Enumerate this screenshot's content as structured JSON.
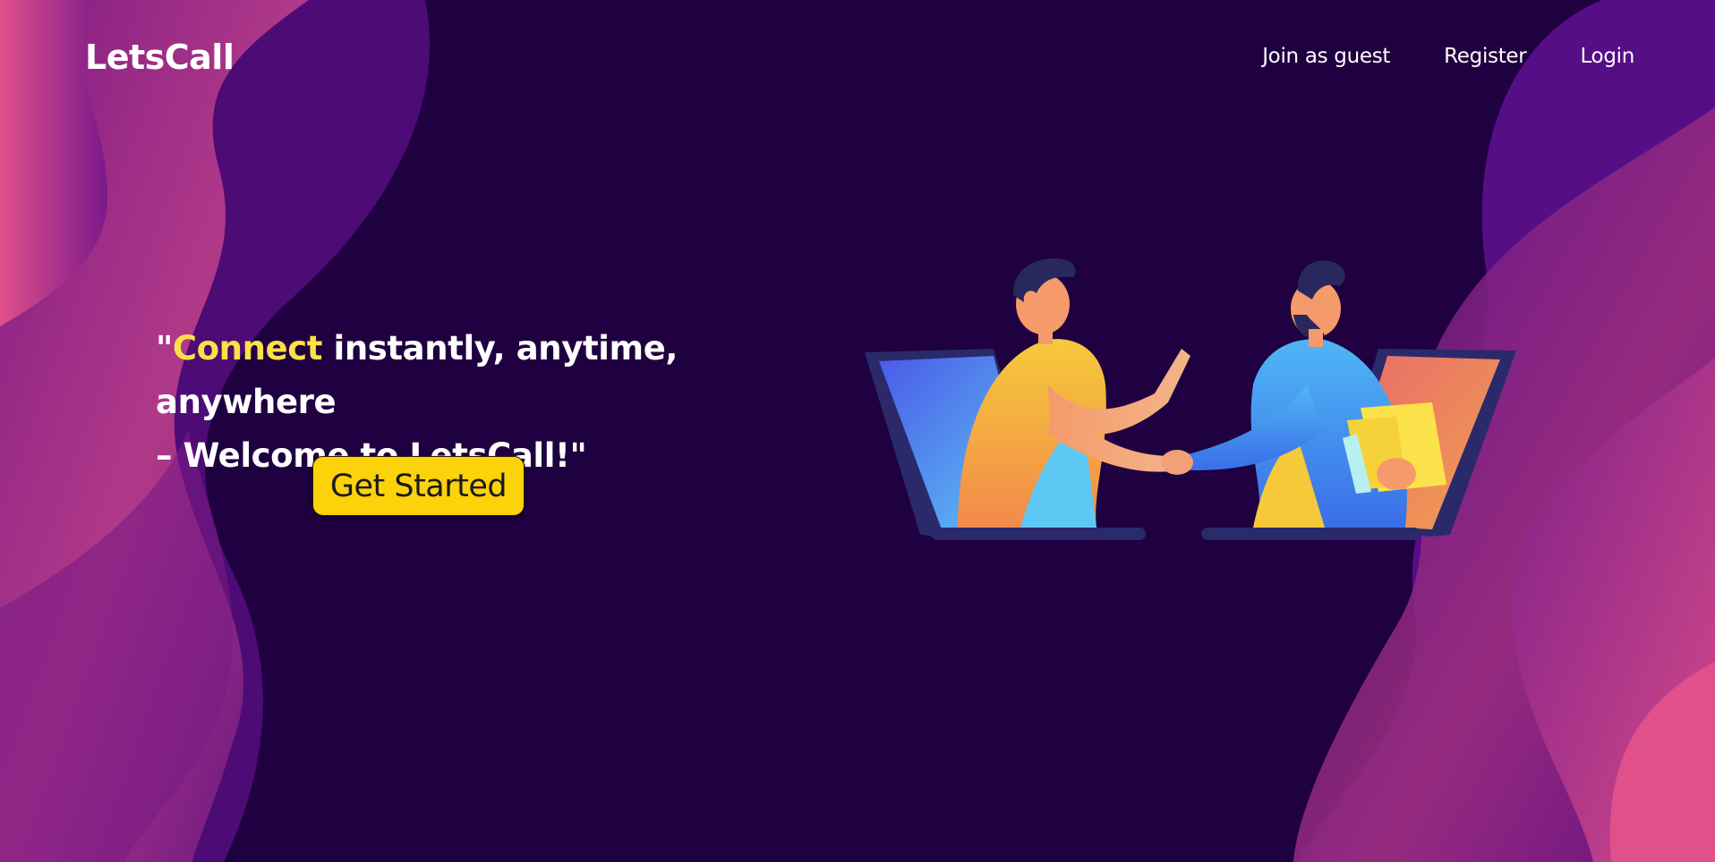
{
  "brand": {
    "name": "LetsCall"
  },
  "nav": {
    "items": [
      {
        "label": "Join as guest"
      },
      {
        "label": "Register"
      },
      {
        "label": "Login"
      }
    ]
  },
  "hero": {
    "quote_open": "\"",
    "highlight": "Connect",
    "line1_rest": " instantly, anytime, anywhere",
    "line2": "– Welcome to LetsCall!\"",
    "cta_label": "Get Started"
  },
  "theme": {
    "background": "#1f0040",
    "accent": "#fde047",
    "cta": "#fcd20a",
    "wave_pink": "#d94a8c",
    "wave_purple": "#5a0f8a"
  },
  "illustration": {
    "icon": "video-call-handshake-illustration"
  }
}
